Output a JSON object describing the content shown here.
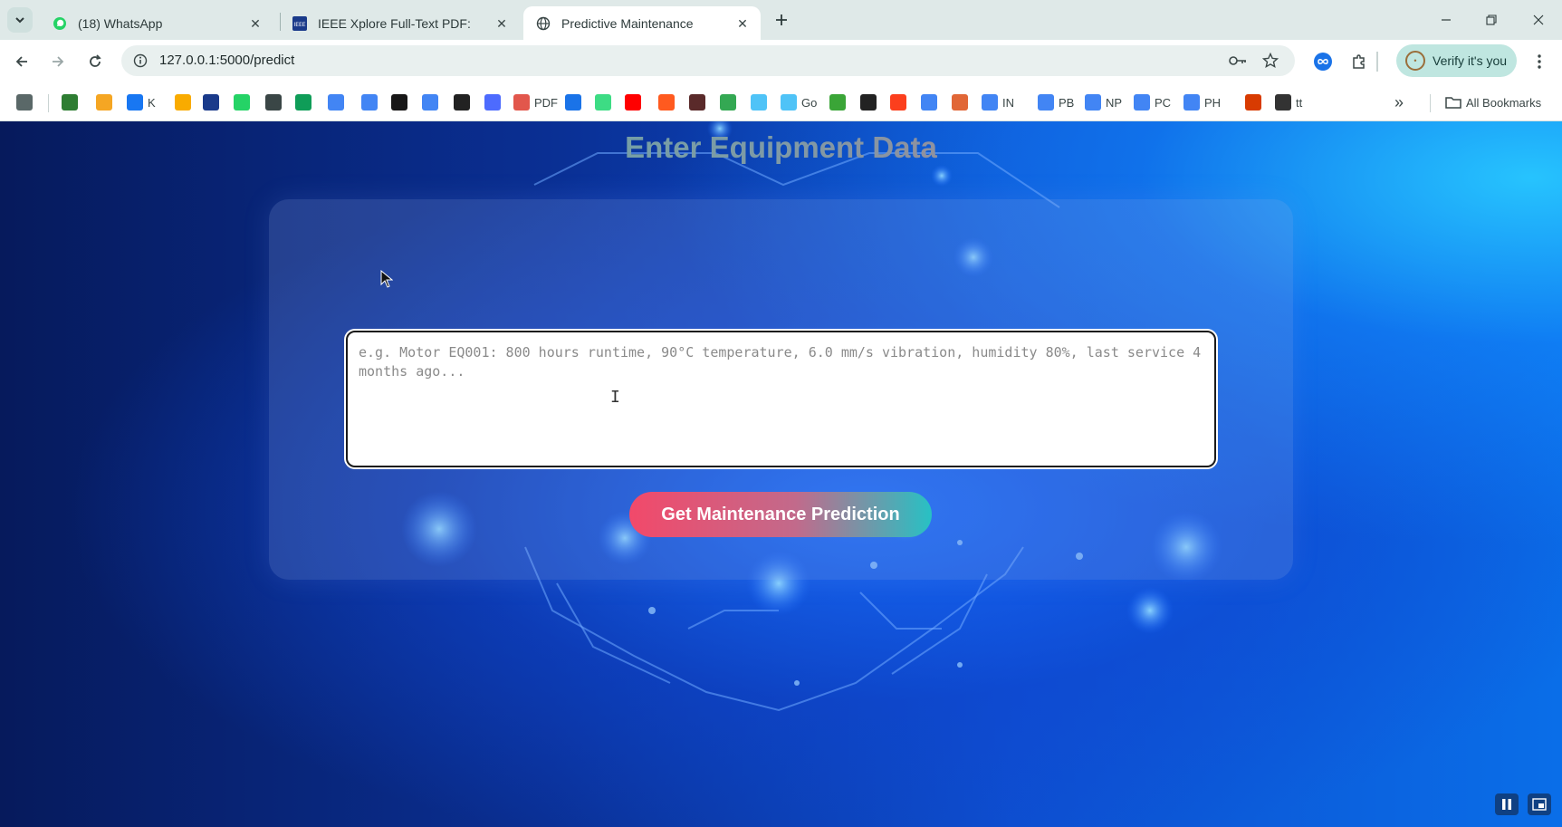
{
  "browser": {
    "tabs": [
      {
        "label": "(18) WhatsApp",
        "icon": "whatsapp-icon"
      },
      {
        "label": "IEEE Xplore Full-Text PDF:",
        "icon": "ieee-icon"
      },
      {
        "label": "Predictive Maintenance",
        "icon": "globe-icon",
        "active": true
      }
    ],
    "address": "127.0.0.1:5000/predict",
    "verify_label": "Verify it's you",
    "bookmarks": [
      {
        "label": "",
        "icon": "apps-grid-icon",
        "color": "#5a6868"
      },
      {
        "label": "",
        "icon": "android-icon",
        "color": "#2e7d32"
      },
      {
        "label": "",
        "icon": "bookmark-orange-icon",
        "color": "#f5a623"
      },
      {
        "label": "K",
        "icon": "facebook-icon",
        "color": "#1877f2"
      },
      {
        "label": "",
        "icon": "analytics-icon",
        "color": "#f9ab00"
      },
      {
        "label": "",
        "icon": "ieee-icon",
        "color": "#1a3a8a"
      },
      {
        "label": "",
        "icon": "whatsapp-icon",
        "color": "#25d366"
      },
      {
        "label": "",
        "icon": "globe-icon",
        "color": "#3a4646"
      },
      {
        "label": "",
        "icon": "sheets-icon",
        "color": "#0f9d58"
      },
      {
        "label": "",
        "icon": "google-icon",
        "color": "#4285f4"
      },
      {
        "label": "",
        "icon": "google-icon",
        "color": "#4285f4"
      },
      {
        "label": "",
        "icon": "github-icon",
        "color": "#181717"
      },
      {
        "label": "",
        "icon": "google-icon",
        "color": "#4285f4"
      },
      {
        "label": "",
        "icon": "openai-icon",
        "color": "#222222"
      },
      {
        "label": "",
        "icon": "deepseek-icon",
        "color": "#4d6bfe"
      },
      {
        "label": "PDF",
        "icon": "pdf-icon",
        "color": "#e2574c"
      },
      {
        "label": "",
        "icon": "bracket-icon",
        "color": "#1a73e8"
      },
      {
        "label": "",
        "icon": "android-head-icon",
        "color": "#3ddc84"
      },
      {
        "label": "",
        "icon": "youtube-icon",
        "color": "#ff0000"
      },
      {
        "label": "",
        "icon": "z-icon",
        "color": "#ff5a1f"
      },
      {
        "label": "",
        "icon": "pill-icon",
        "color": "#5a2a2a"
      },
      {
        "label": "",
        "icon": "ring-icon",
        "color": "#34a853"
      },
      {
        "label": "",
        "icon": "swirl-icon",
        "color": "#4fc3f7"
      },
      {
        "label": "Go",
        "icon": "swirl-icon",
        "color": "#4fc3f7"
      },
      {
        "label": "",
        "icon": "leaf-icon",
        "color": "#3aa537"
      },
      {
        "label": "",
        "icon": "codechef-icon",
        "color": "#222222"
      },
      {
        "label": "",
        "icon": "yandex-icon",
        "color": "#fc3f1d"
      },
      {
        "label": "",
        "icon": "google-icon",
        "color": "#4285f4"
      },
      {
        "label": "",
        "icon": "matlab-icon",
        "color": "#e16737"
      },
      {
        "label": "IN",
        "icon": "google-icon",
        "color": "#4285f4"
      },
      {
        "label": "PB",
        "icon": "google-icon",
        "color": "#4285f4"
      },
      {
        "label": "NP",
        "icon": "google-icon",
        "color": "#4285f4"
      },
      {
        "label": "PC",
        "icon": "google-icon",
        "color": "#4285f4"
      },
      {
        "label": "PH",
        "icon": "google-icon",
        "color": "#4285f4"
      },
      {
        "label": "",
        "icon": "office-icon",
        "color": "#d83b01"
      },
      {
        "label": "tt",
        "icon": "bus-icon",
        "color": "#333333"
      }
    ],
    "all_bookmarks_label": "All Bookmarks"
  },
  "app": {
    "title": "Enter Equipment Data",
    "input_placeholder": "e.g. Motor EQ001: 800 hours runtime, 90°C temperature, 6.0 mm/s vibration, humidity 80%, last service 4 months ago...",
    "button_label": "Get Maintenance Prediction"
  },
  "colors": {
    "accent_pink": "#f2496a",
    "accent_teal": "#27c1c4",
    "page_blue": "#0d4fd0"
  }
}
